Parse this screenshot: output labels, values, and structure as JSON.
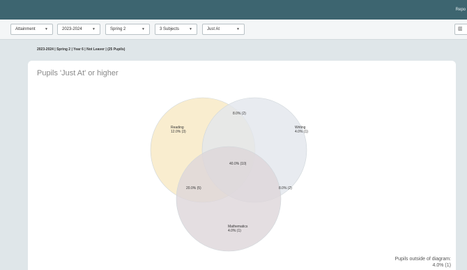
{
  "header": {
    "report_link": "Repo"
  },
  "filters": {
    "measure": "Attainment",
    "year": "2023-2024",
    "term": "Spring 2",
    "subjects": "3 Subjects",
    "threshold": "Just At",
    "chart_toggle_icon": "bar-chart-icon"
  },
  "breadcrumb": "2023-2024 | Spring 2 | Year 6 | Not Leaver | (25 Pupils)",
  "card": {
    "title": "Pupils 'Just At' or higher"
  },
  "venn": {
    "colors": {
      "reading": "#f7e8c3",
      "writing": "#e2e6ec",
      "mathematics": "#ddd6da"
    },
    "reading": {
      "name": "Reading",
      "value": "12.0% (3)"
    },
    "writing": {
      "name": "Writing",
      "value": "4.0% (1)"
    },
    "mathematics": {
      "name": "Mathematics",
      "value": "4.0% (1)"
    },
    "reading_writing": "8.0% (2)",
    "reading_mathematics": "20.0% (5)",
    "writing_mathematics": "8.0% (2)",
    "all_three": "40.0% (10)"
  },
  "outside": {
    "label": "Pupils outside of diagram:",
    "value": "4.0% (1)"
  }
}
